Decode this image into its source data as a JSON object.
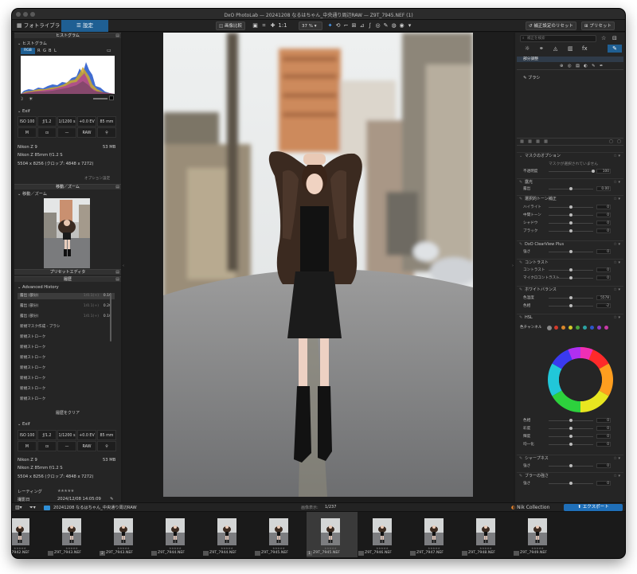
{
  "window": {
    "title": "DxO PhotoLab — 20241208 なるはちゃん_中央通り周辺RAW — Z9T_7945.NEF (1)"
  },
  "tabs": {
    "library": "フォトライブラリ",
    "customize": "設定"
  },
  "toolbar": {
    "compare": "画像比較",
    "ratio": "1:1",
    "zoom": "37 %",
    "reset": "補正設定のリセット",
    "preset": "プリセット"
  },
  "left": {
    "histogram": {
      "header": "ヒストグラム",
      "title": "ヒストグラム",
      "channels": [
        "RGB",
        "R",
        "G",
        "B",
        "L"
      ]
    },
    "exif": {
      "title": "Exif",
      "cells": [
        "ISO 100",
        "ƒ/1.2",
        "1/1200 s",
        "+0.0 EV",
        "85 mm",
        "M",
        "—",
        "RAW"
      ],
      "camera": "Nikon Z 9",
      "size": "53 MB",
      "lens": "Nikon Z 85mm f/1.2 S",
      "dimensions": "5504 x 8256 (クロップ: 4848 x 7272)",
      "option": "オプション設定"
    },
    "move_zoom": {
      "header": "移動／ズーム",
      "title": "移動／ズーム"
    },
    "preset_editor": {
      "header": "プリセットエディタ"
    },
    "history": {
      "header": "履歴",
      "title": "Advanced History",
      "rows": [
        {
          "label": "露出 (部分)",
          "key": "1/0.1(+)",
          "value": "0.10",
          "selected": true
        },
        {
          "label": "露出 (部分)",
          "key": "1/0.1(+)",
          "value": "0.20",
          "selected": false
        },
        {
          "label": "露出 (部分)",
          "key": "1/0.1(+)",
          "value": "0.10",
          "selected": false
        },
        {
          "label": "新規マスク作成 - ブラシ",
          "key": "",
          "value": "",
          "selected": false
        },
        {
          "label": "新規ストローク",
          "key": "",
          "value": "",
          "selected": false
        },
        {
          "label": "新規ストローク",
          "key": "",
          "value": "",
          "selected": false
        },
        {
          "label": "新規ストローク",
          "key": "",
          "value": "",
          "selected": false
        },
        {
          "label": "新規ストローク",
          "key": "",
          "value": "",
          "selected": false
        },
        {
          "label": "新規ストローク",
          "key": "",
          "value": "",
          "selected": false
        },
        {
          "label": "新規ストローク",
          "key": "",
          "value": "",
          "selected": false
        },
        {
          "label": "新規ストローク",
          "key": "",
          "value": "",
          "selected": false
        }
      ],
      "clear": "履歴をクリア"
    },
    "exif2": {
      "title": "Exif",
      "camera": "Nikon Z 9",
      "size": "53 MB",
      "lens": "Nikon Z 85mm f/1.2 S",
      "dimensions": "5504 x 8256 (クロップ: 4848 x 7272)",
      "rating_label": "レーティング",
      "date_label": "撮影日",
      "date": "2024/12/08 14:05:09"
    }
  },
  "right": {
    "search_placeholder": "補正を検索",
    "mask_tab": "部分調整",
    "brush": "ブラシ",
    "mask_options": "マスクのオプション",
    "no_mask": "マスクが選択されていません",
    "opacity": {
      "label": "不透明度",
      "value": "100"
    },
    "exposure": {
      "title": "露光",
      "label": "露出",
      "value": "0.00"
    },
    "tone": {
      "title": "選択的トーン補正",
      "rows": [
        {
          "label": "ハイライト",
          "value": "0"
        },
        {
          "label": "中間トーン",
          "value": "0"
        },
        {
          "label": "シャドウ",
          "value": "0"
        },
        {
          "label": "ブラック",
          "value": "0"
        }
      ]
    },
    "clearview": {
      "title": "DxO ClearView Plus",
      "label": "強さ",
      "value": "0"
    },
    "contrast": {
      "title": "コントラスト",
      "rows": [
        {
          "label": "コントラスト",
          "value": "0"
        },
        {
          "label": "マイクロコントラスト",
          "value": "0"
        }
      ]
    },
    "wb": {
      "title": "ホワイトバランス",
      "rows": [
        {
          "label": "色温度",
          "value": "5578"
        },
        {
          "label": "色相",
          "value": "-2"
        }
      ]
    },
    "hsl": {
      "title": "HSL",
      "channel_label": "色チャンネル",
      "swatches": [
        "#8a8a8a",
        "#d23a2b",
        "#d9862a",
        "#d3c92a",
        "#4aa33d",
        "#2ba3a3",
        "#2b55c9",
        "#8e3cc7",
        "#c93aa6"
      ],
      "rows": [
        {
          "label": "色相",
          "value": "0"
        },
        {
          "label": "彩度",
          "value": "0"
        },
        {
          "label": "輝度",
          "value": "0"
        },
        {
          "label": "均一化",
          "value": "0"
        }
      ]
    },
    "sharpness": {
      "title": "シャープネス",
      "label": "強さ",
      "value": "0"
    },
    "blur": {
      "title": "ブラーの強さ",
      "label": "強さ",
      "value": "0"
    }
  },
  "filmbar": {
    "folder": "20241208 なるはちゃん_中央通り周辺RAW",
    "count_label": "画像表示:",
    "count": "1/237",
    "nik": "Nik Collection",
    "export": "エクスポート"
  },
  "filmstrip": [
    {
      "name": "Z9T_7942.NEF",
      "num": "",
      "selected": false
    },
    {
      "name": "Z9T_7943.NEF",
      "num": "",
      "selected": false
    },
    {
      "name": "Z9T_7943.NEF",
      "num": "2",
      "selected": false
    },
    {
      "name": "Z9T_7944.NEF",
      "num": "",
      "selected": false
    },
    {
      "name": "Z9T_7944.NEF",
      "num": "",
      "selected": false
    },
    {
      "name": "Z9T_7945.NEF",
      "num": "",
      "selected": false
    },
    {
      "name": "Z9T_7945.NEF",
      "num": "1",
      "selected": true
    },
    {
      "name": "Z9T_7946.NEF",
      "num": "",
      "selected": false
    },
    {
      "name": "Z9T_7947.NEF",
      "num": "",
      "selected": false
    },
    {
      "name": "Z9T_7948.NEF",
      "num": "",
      "selected": false
    },
    {
      "name": "Z9T_7949.NEF",
      "num": "",
      "selected": false
    },
    {
      "name": "",
      "num": "",
      "selected": false
    }
  ]
}
